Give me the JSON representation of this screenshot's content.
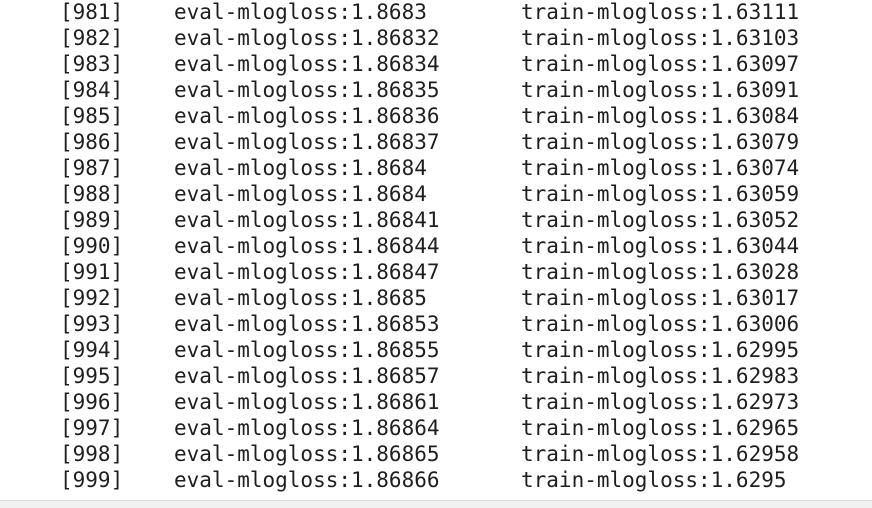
{
  "log": {
    "lines": [
      {
        "iter": "[981]",
        "eval": "eval-mlogloss:1.8683",
        "train": "train-mlogloss:1.63111"
      },
      {
        "iter": "[982]",
        "eval": "eval-mlogloss:1.86832",
        "train": "train-mlogloss:1.63103"
      },
      {
        "iter": "[983]",
        "eval": "eval-mlogloss:1.86834",
        "train": "train-mlogloss:1.63097"
      },
      {
        "iter": "[984]",
        "eval": "eval-mlogloss:1.86835",
        "train": "train-mlogloss:1.63091"
      },
      {
        "iter": "[985]",
        "eval": "eval-mlogloss:1.86836",
        "train": "train-mlogloss:1.63084"
      },
      {
        "iter": "[986]",
        "eval": "eval-mlogloss:1.86837",
        "train": "train-mlogloss:1.63079"
      },
      {
        "iter": "[987]",
        "eval": "eval-mlogloss:1.8684",
        "train": "train-mlogloss:1.63074"
      },
      {
        "iter": "[988]",
        "eval": "eval-mlogloss:1.8684",
        "train": "train-mlogloss:1.63059"
      },
      {
        "iter": "[989]",
        "eval": "eval-mlogloss:1.86841",
        "train": "train-mlogloss:1.63052"
      },
      {
        "iter": "[990]",
        "eval": "eval-mlogloss:1.86844",
        "train": "train-mlogloss:1.63044"
      },
      {
        "iter": "[991]",
        "eval": "eval-mlogloss:1.86847",
        "train": "train-mlogloss:1.63028"
      },
      {
        "iter": "[992]",
        "eval": "eval-mlogloss:1.8685",
        "train": "train-mlogloss:1.63017"
      },
      {
        "iter": "[993]",
        "eval": "eval-mlogloss:1.86853",
        "train": "train-mlogloss:1.63006"
      },
      {
        "iter": "[994]",
        "eval": "eval-mlogloss:1.86855",
        "train": "train-mlogloss:1.62995"
      },
      {
        "iter": "[995]",
        "eval": "eval-mlogloss:1.86857",
        "train": "train-mlogloss:1.62983"
      },
      {
        "iter": "[996]",
        "eval": "eval-mlogloss:1.86861",
        "train": "train-mlogloss:1.62973"
      },
      {
        "iter": "[997]",
        "eval": "eval-mlogloss:1.86864",
        "train": "train-mlogloss:1.62965"
      },
      {
        "iter": "[998]",
        "eval": "eval-mlogloss:1.86865",
        "train": "train-mlogloss:1.62958"
      },
      {
        "iter": "[999]",
        "eval": "eval-mlogloss:1.86866",
        "train": "train-mlogloss:1.6295"
      }
    ]
  }
}
